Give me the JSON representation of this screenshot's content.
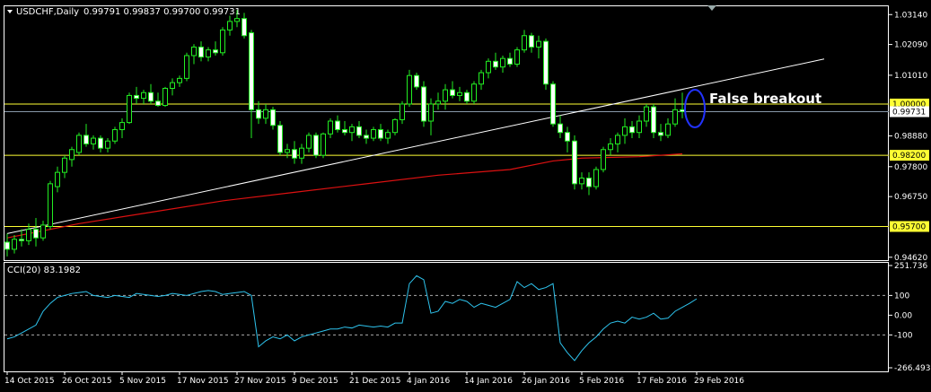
{
  "chart_data": [
    {
      "type": "candlestick",
      "symbol_header": "USDCHF,Daily",
      "ohlc_header": "0.99791 0.99837 0.99700 0.99731",
      "ylim": [
        0.9455,
        1.034
      ],
      "price_ticks": [
        "1.03140",
        "1.02090",
        "1.01010",
        "0.99731",
        "0.98880",
        "0.97800",
        "0.96750",
        "0.94620"
      ],
      "price_tick_values": [
        1.0314,
        1.0209,
        1.0101,
        0.99731,
        0.9888,
        0.978,
        0.9675,
        0.9462
      ],
      "horizontal_levels": [
        {
          "label": "1.00000",
          "value": 1.0
        },
        {
          "label": "0.98200",
          "value": 0.982
        },
        {
          "label": "0.95700",
          "value": 0.957
        }
      ],
      "current_price": {
        "label": "0.99731",
        "value": 0.99731
      },
      "trendline": {
        "start": [
          0,
          0.9545
        ],
        "end": [
          100,
          1.0158
        ]
      },
      "annotation": "False breakout",
      "ma_series": [
        [
          0,
          0.953
        ],
        [
          10,
          0.958
        ],
        [
          20,
          0.962
        ],
        [
          30,
          0.966
        ],
        [
          40,
          0.969
        ],
        [
          50,
          0.972
        ],
        [
          60,
          0.975
        ],
        [
          70,
          0.977
        ],
        [
          76,
          0.98
        ],
        [
          80,
          0.981
        ],
        [
          88,
          0.9815
        ],
        [
          94,
          0.9825
        ]
      ],
      "x_labels": [
        "14 Oct 2015",
        "26 Oct 2015",
        "5 Nov 2015",
        "17 Nov 2015",
        "27 Nov 2015",
        "9 Dec 2015",
        "21 Dec 2015",
        "4 Jan 2016",
        "14 Jan 2016",
        "26 Jan 2016",
        "5 Feb 2016",
        "17 Feb 2016",
        "29 Feb 2016"
      ],
      "x_label_index": [
        0,
        8,
        16,
        24,
        32,
        40,
        48,
        56,
        64,
        72,
        80,
        88,
        96
      ],
      "candles": [
        [
          0.9515,
          0.9545,
          0.9465,
          0.949
        ],
        [
          0.949,
          0.954,
          0.9475,
          0.9525
        ],
        [
          0.9525,
          0.956,
          0.95,
          0.952
        ],
        [
          0.952,
          0.958,
          0.9505,
          0.956
        ],
        [
          0.956,
          0.96,
          0.95,
          0.953
        ],
        [
          0.953,
          0.959,
          0.952,
          0.9575
        ],
        [
          0.957,
          0.973,
          0.956,
          0.972
        ],
        [
          0.971,
          0.978,
          0.969,
          0.976
        ],
        [
          0.976,
          0.982,
          0.974,
          0.981
        ],
        [
          0.9805,
          0.985,
          0.978,
          0.984
        ],
        [
          0.983,
          0.99,
          0.982,
          0.989
        ],
        [
          0.989,
          0.993,
          0.985,
          0.986
        ],
        [
          0.986,
          0.989,
          0.984,
          0.988
        ],
        [
          0.988,
          0.989,
          0.983,
          0.9845
        ],
        [
          0.9845,
          0.988,
          0.983,
          0.987
        ],
        [
          0.987,
          0.992,
          0.986,
          0.991
        ],
        [
          0.991,
          0.995,
          0.988,
          0.9935
        ],
        [
          0.9935,
          1.004,
          0.993,
          1.003
        ],
        [
          1.003,
          1.006,
          1.0,
          1.002
        ],
        [
          1.002,
          1.005,
          1.0,
          1.004
        ],
        [
          1.004,
          1.007,
          1.0,
          1.001
        ],
        [
          1.001,
          1.004,
          0.999,
          0.9995
        ],
        [
          0.9995,
          1.006,
          0.999,
          1.0055
        ],
        [
          1.0055,
          1.009,
          1.003,
          1.0075
        ],
        [
          1.0075,
          1.01,
          1.006,
          1.009
        ],
        [
          1.009,
          1.018,
          1.008,
          1.017
        ],
        [
          1.017,
          1.021,
          1.014,
          1.02
        ],
        [
          1.02,
          1.022,
          1.015,
          1.0165
        ],
        [
          1.0165,
          1.02,
          1.015,
          1.019
        ],
        [
          1.019,
          1.022,
          1.017,
          1.018
        ],
        [
          1.018,
          1.027,
          1.017,
          1.026
        ],
        [
          1.026,
          1.031,
          1.024,
          1.029
        ],
        [
          1.029,
          1.033,
          1.027,
          1.03
        ],
        [
          1.03,
          1.032,
          1.023,
          1.024
        ],
        [
          1.025,
          1.026,
          0.988,
          0.998
        ],
        [
          0.998,
          1.001,
          0.993,
          0.995
        ],
        [
          0.995,
          1.0,
          0.993,
          0.998
        ],
        [
          0.998,
          0.999,
          0.991,
          0.9925
        ],
        [
          0.9925,
          0.994,
          0.982,
          0.983
        ],
        [
          0.983,
          0.986,
          0.981,
          0.984
        ],
        [
          0.984,
          0.987,
          0.979,
          0.981
        ],
        [
          0.981,
          0.986,
          0.979,
          0.9845
        ],
        [
          0.9845,
          0.99,
          0.983,
          0.989
        ],
        [
          0.989,
          0.99,
          0.981,
          0.982
        ],
        [
          0.982,
          0.99,
          0.981,
          0.9895
        ],
        [
          0.9895,
          0.995,
          0.988,
          0.994
        ],
        [
          0.994,
          0.996,
          0.99,
          0.991
        ],
        [
          0.991,
          0.994,
          0.989,
          0.99
        ],
        [
          0.99,
          0.993,
          0.987,
          0.992
        ],
        [
          0.992,
          0.994,
          0.988,
          0.989
        ],
        [
          0.989,
          0.991,
          0.986,
          0.988
        ],
        [
          0.988,
          0.992,
          0.987,
          0.991
        ],
        [
          0.991,
          0.993,
          0.987,
          0.988
        ],
        [
          0.988,
          0.991,
          0.986,
          0.99
        ],
        [
          0.99,
          0.995,
          0.989,
          0.9945
        ],
        [
          0.9945,
          1.001,
          0.993,
          1.0
        ],
        [
          1.0,
          1.012,
          0.999,
          1.01
        ],
        [
          1.01,
          1.011,
          1.005,
          1.006
        ],
        [
          1.006,
          1.008,
          0.992,
          0.994
        ],
        [
          0.994,
          1.002,
          0.989,
          1.0
        ],
        [
          1.0,
          1.004,
          0.998,
          1.001
        ],
        [
          1.001,
          1.007,
          0.998,
          1.005
        ],
        [
          1.005,
          1.008,
          1.002,
          1.003
        ],
        [
          1.003,
          1.006,
          1.001,
          1.004
        ],
        [
          1.004,
          1.005,
          1.0,
          1.001
        ],
        [
          1.001,
          1.008,
          1.0,
          1.007
        ],
        [
          1.007,
          1.012,
          1.005,
          1.011
        ],
        [
          1.011,
          1.016,
          1.009,
          1.015
        ],
        [
          1.015,
          1.018,
          1.012,
          1.013
        ],
        [
          1.013,
          1.017,
          1.011,
          1.016
        ],
        [
          1.016,
          1.018,
          1.013,
          1.014
        ],
        [
          1.014,
          1.02,
          1.013,
          1.019
        ],
        [
          1.019,
          1.026,
          1.018,
          1.024
        ],
        [
          1.024,
          1.025,
          1.018,
          1.02
        ],
        [
          1.02,
          1.024,
          1.016,
          1.022
        ],
        [
          1.022,
          1.023,
          1.005,
          1.007
        ],
        [
          1.007,
          1.008,
          0.992,
          0.993
        ],
        [
          0.993,
          0.996,
          0.988,
          0.99
        ],
        [
          0.99,
          0.992,
          0.983,
          0.987
        ],
        [
          0.987,
          0.989,
          0.97,
          0.972
        ],
        [
          0.972,
          0.976,
          0.97,
          0.974
        ],
        [
          0.974,
          0.976,
          0.968,
          0.971
        ],
        [
          0.971,
          0.978,
          0.97,
          0.977
        ],
        [
          0.977,
          0.985,
          0.976,
          0.984
        ],
        [
          0.984,
          0.988,
          0.982,
          0.986
        ],
        [
          0.986,
          0.99,
          0.983,
          0.989
        ],
        [
          0.989,
          0.995,
          0.986,
          0.992
        ],
        [
          0.992,
          0.994,
          0.988,
          0.99
        ],
        [
          0.99,
          0.996,
          0.988,
          0.994
        ],
        [
          0.994,
          1.0,
          0.992,
          0.999
        ],
        [
          0.999,
          1.0,
          0.988,
          0.99
        ],
        [
          0.99,
          0.993,
          0.987,
          0.989
        ],
        [
          0.989,
          0.995,
          0.988,
          0.993
        ],
        [
          0.993,
          1.002,
          0.992,
          0.998
        ],
        [
          0.998,
          1.004,
          0.995,
          0.9973
        ]
      ]
    },
    {
      "type": "line",
      "indicator_header": "CCI(20) 83.1982",
      "ylim": [
        -266.4931,
        251.736
      ],
      "y_ticks": [
        "251.736",
        "100",
        "0.00",
        "-100",
        "-266.4931"
      ],
      "y_tick_values": [
        251.736,
        100,
        0,
        -100,
        -266.4931
      ],
      "levels": [
        100,
        -100
      ],
      "values": [
        -120,
        -110,
        -90,
        -70,
        -50,
        20,
        60,
        90,
        100,
        110,
        115,
        120,
        100,
        95,
        90,
        100,
        95,
        90,
        110,
        105,
        100,
        95,
        100,
        110,
        105,
        100,
        110,
        120,
        125,
        120,
        105,
        110,
        115,
        120,
        100,
        -160,
        -130,
        -110,
        -120,
        -100,
        -130,
        -110,
        -100,
        -90,
        -80,
        -70,
        -70,
        -60,
        -65,
        -50,
        -55,
        -60,
        -55,
        -60,
        -40,
        -40,
        160,
        200,
        180,
        10,
        20,
        70,
        60,
        80,
        70,
        40,
        60,
        50,
        40,
        60,
        80,
        170,
        140,
        160,
        130,
        140,
        160,
        -140,
        -190,
        -230,
        -180,
        -140,
        -110,
        -70,
        -40,
        -30,
        -40,
        -10,
        -20,
        -10,
        10,
        -20,
        -15,
        20,
        40,
        60,
        83
      ]
    }
  ]
}
